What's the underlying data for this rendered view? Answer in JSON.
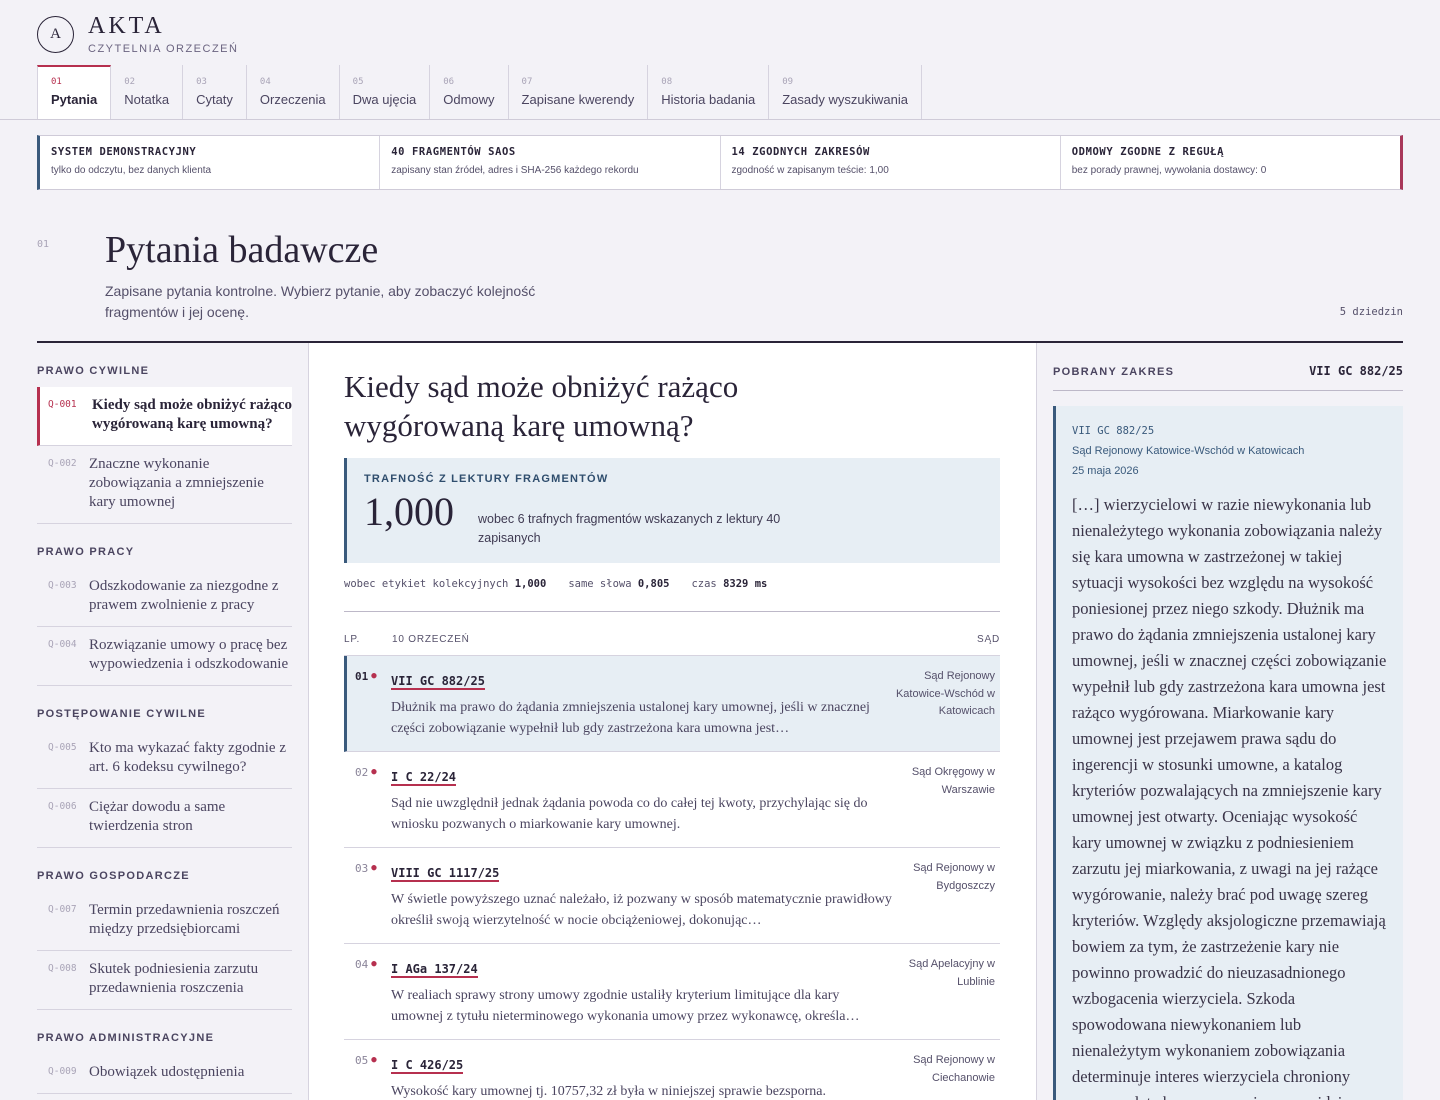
{
  "brand": {
    "logo": "A",
    "title": "AKTA",
    "subtitle": "CZYTELNIA ORZECZEŃ"
  },
  "tabs": [
    {
      "num": "01",
      "label": "Pytania",
      "active": true
    },
    {
      "num": "02",
      "label": "Notatka"
    },
    {
      "num": "03",
      "label": "Cytaty"
    },
    {
      "num": "04",
      "label": "Orzeczenia"
    },
    {
      "num": "05",
      "label": "Dwa ujęcia"
    },
    {
      "num": "06",
      "label": "Odmowy"
    },
    {
      "num": "07",
      "label": "Zapisane kwerendy"
    },
    {
      "num": "08",
      "label": "Historia badania"
    },
    {
      "num": "09",
      "label": "Zasady wyszukiwania"
    }
  ],
  "status": [
    {
      "title": "SYSTEM DEMONSTRACYJNY",
      "sub": "tylko do odczytu, bez danych klienta"
    },
    {
      "title": "40 FRAGMENTÓW SAOS",
      "sub": "zapisany stan źródeł, adres i SHA-256 każdego rekordu"
    },
    {
      "title": "14 ZGODNYCH ZAKRESÓW",
      "sub": "zgodność w zapisanym teście: 1,00"
    },
    {
      "title": "ODMOWY ZGODNE Z REGUŁĄ",
      "sub": "bez porady prawnej, wywołania dostawcy: 0"
    }
  ],
  "section": {
    "num": "01",
    "title": "Pytania badawcze",
    "desc": "Zapisane pytania kontrolne. Wybierz pytanie, aby zobaczyć kolejność fragmentów i jej ocenę.",
    "count": "5 dziedzin"
  },
  "categories": [
    {
      "name": "PRAWO CYWILNE",
      "questions": [
        {
          "id": "Q-001",
          "text": "Kiedy sąd może obniżyć rażąco wygórowaną karę umowną?",
          "active": true
        },
        {
          "id": "Q-002",
          "text": "Znaczne wykonanie zobowiązania a zmniejszenie kary umownej"
        }
      ]
    },
    {
      "name": "PRAWO PRACY",
      "questions": [
        {
          "id": "Q-003",
          "text": "Odszkodowanie za niezgodne z prawem zwolnienie z pracy"
        },
        {
          "id": "Q-004",
          "text": "Rozwiązanie umowy o pracę bez wypowiedzenia i odszkodowanie"
        }
      ]
    },
    {
      "name": "POSTĘPOWANIE CYWILNE",
      "questions": [
        {
          "id": "Q-005",
          "text": "Kto ma wykazać fakty zgodnie z art. 6 kodeksu cywilnego?"
        },
        {
          "id": "Q-006",
          "text": "Ciężar dowodu a same twierdzenia stron"
        }
      ]
    },
    {
      "name": "PRAWO GOSPODARCZE",
      "questions": [
        {
          "id": "Q-007",
          "text": "Termin przedawnienia roszczeń między przedsiębiorcami"
        },
        {
          "id": "Q-008",
          "text": "Skutek podniesienia zarzutu przedawnienia roszczenia"
        }
      ]
    },
    {
      "name": "PRAWO ADMINISTRACYJNE",
      "questions": [
        {
          "id": "Q-009",
          "text": "Obowiązek udostępnienia"
        }
      ]
    }
  ],
  "question": {
    "title": "Kiedy sąd może obniżyć rażąco wygórowaną karę umowną?",
    "score_label": "TRAFNOŚĆ Z LEKTURY FRAGMENTÓW",
    "score_value": "1,000",
    "score_desc": "wobec 6 trafnych fragmentów wskazanych z lektury 40 zapisanych",
    "metrics": [
      {
        "label": "wobec etykiet kolekcyjnych",
        "value": "1,000"
      },
      {
        "label": "same słowa",
        "value": "0,805"
      },
      {
        "label": "czas",
        "value": "8329 ms"
      }
    ],
    "list_head": {
      "lp": "LP.",
      "count": "10 ORZECZEŃ",
      "court": "SĄD"
    }
  },
  "results": [
    {
      "lp": "01",
      "sig": "VII GC 882/25",
      "text": "Dłużnik ma prawo do żądania zmniejszenia ustalonej kary umownej, jeśli w znacznej części zobowiązanie wypełnił lub gdy zastrzeżona kara umowna jest…",
      "court": "Sąd Rejonowy Katowice-Wschód w Katowicach",
      "active": true
    },
    {
      "lp": "02",
      "sig": "I C 22/24",
      "text": "Sąd nie uwzględnił jednak żądania powoda co do całej tej kwoty, przychylając się do wniosku pozwanych o miarkowanie kary umownej.",
      "court": "Sąd Okręgowy w Warszawie"
    },
    {
      "lp": "03",
      "sig": "VIII GC 1117/25",
      "text": "W świetle powyższego uznać należało, iż pozwany w sposób matematycznie prawidłowy określił swoją wierzytelność w nocie obciążeniowej, dokonując…",
      "court": "Sąd Rejonowy w Bydgoszczy"
    },
    {
      "lp": "04",
      "sig": "I AGa 137/24",
      "text": "W realiach sprawy strony umowy zgodnie ustaliły kryterium limitujące dla kary umownej z tytułu nieterminowego wykonania umowy przez wykonawcę, określa…",
      "court": "Sąd Apelacyjny w Lublinie"
    },
    {
      "lp": "05",
      "sig": "I C 426/25",
      "text": "Wysokość kary umownej tj. 10757,32 zł była w niniejszej sprawie bezsporna.",
      "court": "Sąd Rejonowy w Ciechanowie"
    }
  ],
  "range": {
    "label": "POBRANY ZAKRES",
    "sig": "VII GC 882/25",
    "meta_sig": "VII GC 882/25",
    "court": "Sąd Rejonowy Katowice-Wschód w Katowicach",
    "date": "25 maja 2026",
    "text": "[…] wierzycielowi w razie niewykonania lub nienależytego wykonania zobowiązania należy się kara umowna w zastrzeżonej w takiej sytuacji wysokości bez względu na wysokość poniesionej przez niego szkody. Dłużnik ma prawo do żądania zmniejszenia ustalonej kary umownej, jeśli w znacznej części zobowiązanie wypełnił lub gdy zastrzeżona kara umowna jest rażąco wygórowana. Miarkowanie kary umownej jest przejawem prawa sądu do ingerencji w stosunki umowne, a katalog kryteriów pozwalających na zmniejszenie kary umownej jest otwarty. Oceniając wysokość kary umownej w związku z podniesieniem zarzutu jej miarkowania, z uwagi na jej rażące wygórowanie, należy brać pod uwagę szereg kryteriów. Względy aksjologiczne przemawiają bowiem za tym, że zastrzeżenie kary nie powinno prowadzić do nieuzasadnionego wzbogacenia wierzyciela. Szkoda spowodowana niewykonaniem lub nienależytym wykonaniem zobowiązania determinuje interes wierzyciela chroniony przez zapłatę kary umownej, a przewidziane w art."
  },
  "colors": {
    "accent": "#b6304f",
    "blue": "#3a5a7c",
    "panel": "#e7eef4"
  }
}
